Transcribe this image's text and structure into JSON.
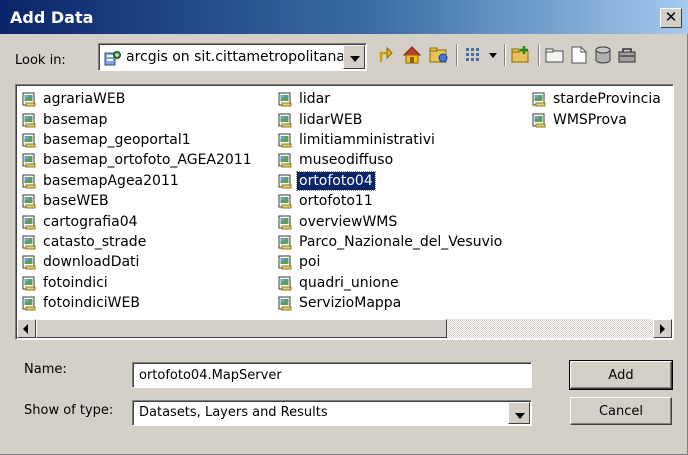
{
  "window": {
    "title": "Add Data",
    "close_glyph": "✕"
  },
  "toolbar": {
    "look_in_label": "Look in:",
    "look_in_value": "arcgis on sit.cittametropolitana.",
    "icons": [
      "up-one-level-icon",
      "home-icon",
      "connect-folder-icon",
      "view-list-icon",
      "view-menu-icon",
      "new-connection-icon",
      "new-folder-icon",
      "new-file-icon",
      "database-icon",
      "toolbox-icon"
    ]
  },
  "files": {
    "columns": [
      [
        "agrariaWEB",
        "basemap",
        "basemap_geoportal1",
        "basemap_ortofoto_AGEA2011",
        "basemapAgea2011",
        "baseWEB",
        "cartografia04",
        "catasto_strade",
        "downloadDati",
        "fotoindici",
        "fotoindiciWEB"
      ],
      [
        "lidar",
        "lidarWEB",
        "limitiamministrativi",
        "museodiffuso",
        "ortofoto04",
        "ortofoto11",
        "overviewWMS",
        "Parco_Nazionale_del_Vesuvio",
        "poi",
        "quadri_unione",
        "ServizioMappa"
      ],
      [
        "stardeProvincia",
        "WMSProva"
      ]
    ],
    "selected": "ortofoto04"
  },
  "form": {
    "name_label": "Name:",
    "name_value": "ortofoto04.MapServer",
    "type_label": "Show of type:",
    "type_value": "Datasets, Layers and Results",
    "add_label": "Add",
    "cancel_label": "Cancel"
  },
  "colors": {
    "title_bar": "#0a246a",
    "dialog_bg": "#d4d0c8",
    "selection": "#0a246a"
  }
}
